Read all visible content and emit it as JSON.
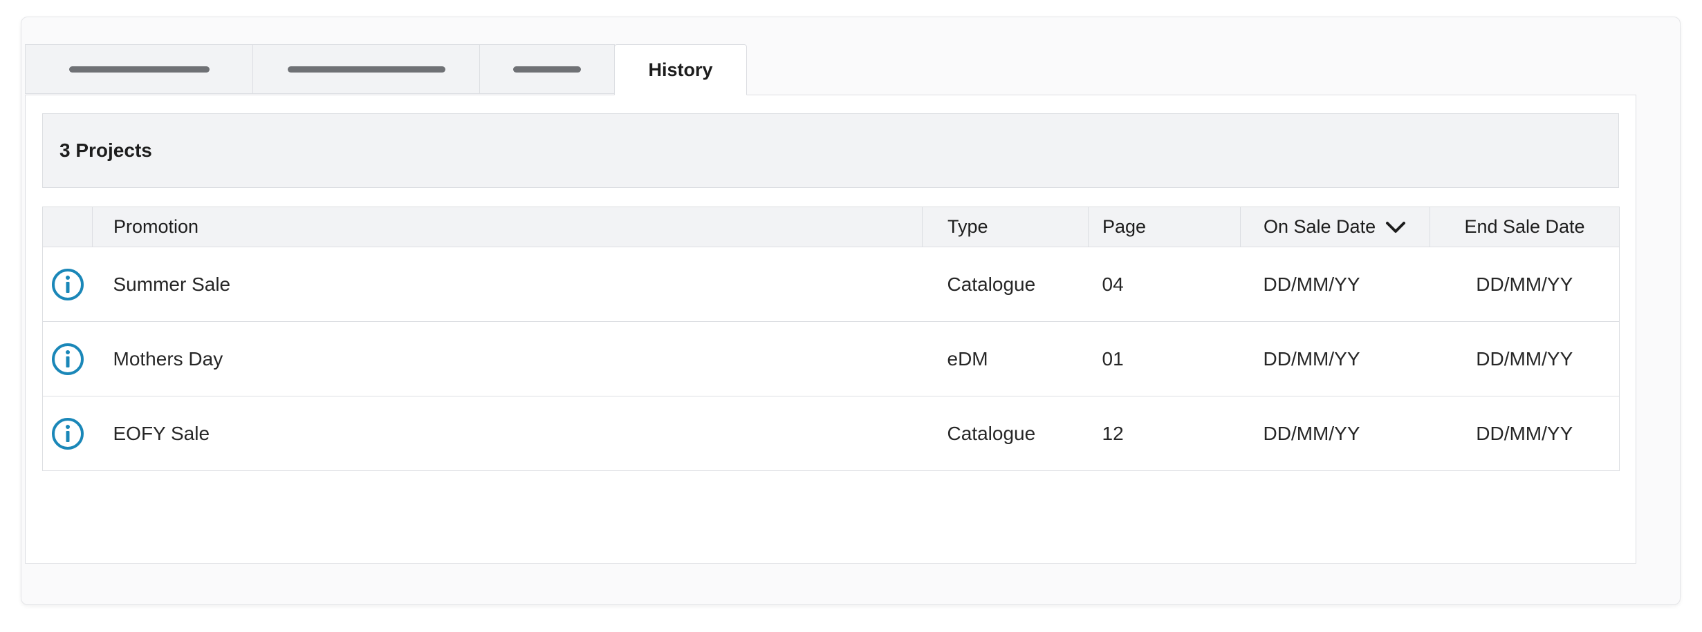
{
  "tabs": [
    {
      "label": "",
      "placeholder": true
    },
    {
      "label": "",
      "placeholder": true
    },
    {
      "label": "",
      "placeholder": true
    },
    {
      "label": "History",
      "placeholder": false
    }
  ],
  "summary": {
    "label": "3 Projects"
  },
  "table": {
    "columns": {
      "promotion": "Promotion",
      "type": "Type",
      "page": "Page",
      "on_sale_date": "On Sale Date",
      "end_sale_date": "End Sale Date"
    },
    "sort_icon": "chevron-down-icon",
    "rows": [
      {
        "promotion": "Summer Sale",
        "type": "Catalogue",
        "page": "04",
        "on_sale_date": "DD/MM/YY",
        "end_sale_date": "DD/MM/YY"
      },
      {
        "promotion": "Mothers Day",
        "type": "eDM",
        "page": "01",
        "on_sale_date": "DD/MM/YY",
        "end_sale_date": "DD/MM/YY"
      },
      {
        "promotion": "EOFY Sale",
        "type": "Catalogue",
        "page": "12",
        "on_sale_date": "DD/MM/YY",
        "end_sale_date": "DD/MM/YY"
      }
    ],
    "row_icon": "info-icon"
  },
  "colors": {
    "accent": "#1a87b8",
    "header_bg": "#f2f3f5",
    "border": "#dcdee2",
    "placeholder_bar": "#6f7175"
  }
}
